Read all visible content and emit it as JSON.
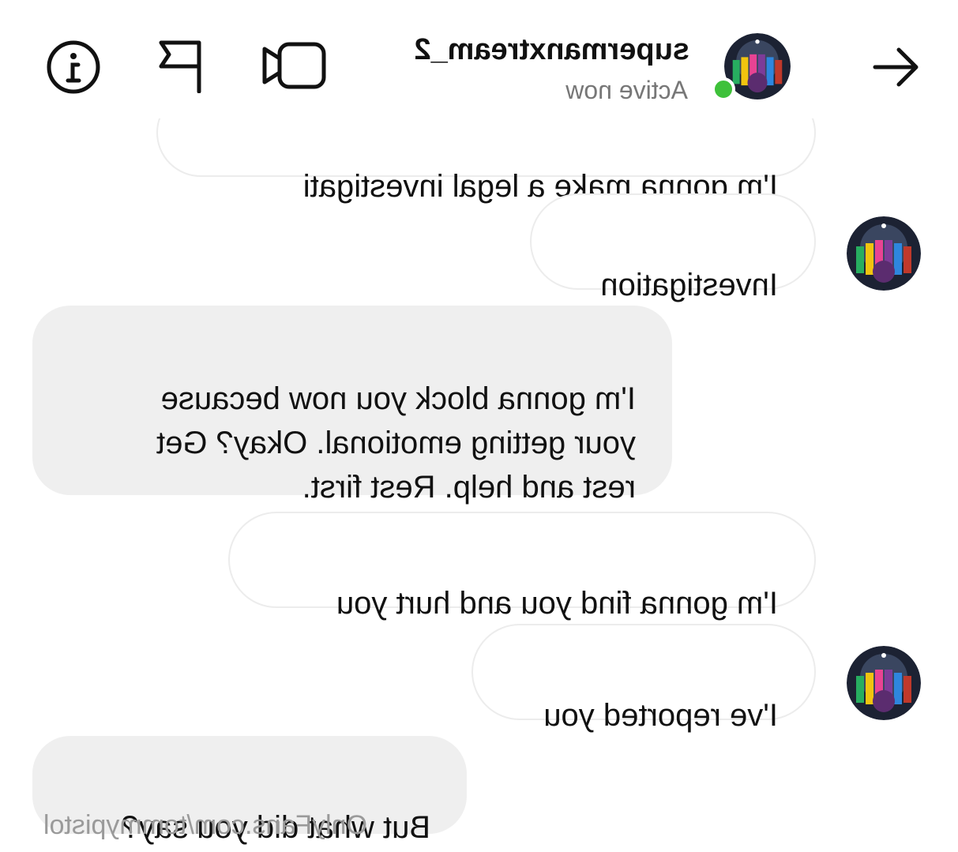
{
  "header": {
    "username": "supermanxtream_2",
    "status": "Active now",
    "icons": {
      "back": "arrow-left-icon",
      "video": "video-call-icon",
      "flag": "flag-icon",
      "info": "info-icon"
    },
    "online_color": "#3ec13a"
  },
  "messages": [
    {
      "direction": "in",
      "text": "I'm gonna make a legal investigati",
      "avatar": false
    },
    {
      "direction": "in",
      "text": "Investigation",
      "avatar": true
    },
    {
      "direction": "out",
      "text": "I'm gonna block you now because\nyour getting emotional. Okay? Get\nrest and help. Rest first.",
      "avatar": false
    },
    {
      "direction": "in",
      "text": "I'm gonna find you and hurt you",
      "avatar": false
    },
    {
      "direction": "in",
      "text": "I've reported you",
      "avatar": true
    },
    {
      "direction": "out",
      "text": "But what did you say?",
      "avatar": false
    }
  ],
  "watermark": "OnlyFans.com/tommypistol",
  "colors": {
    "incoming_bubble": "#ffffff",
    "outgoing_bubble": "#efefef",
    "status_text": "#777777"
  },
  "mirrored": true
}
